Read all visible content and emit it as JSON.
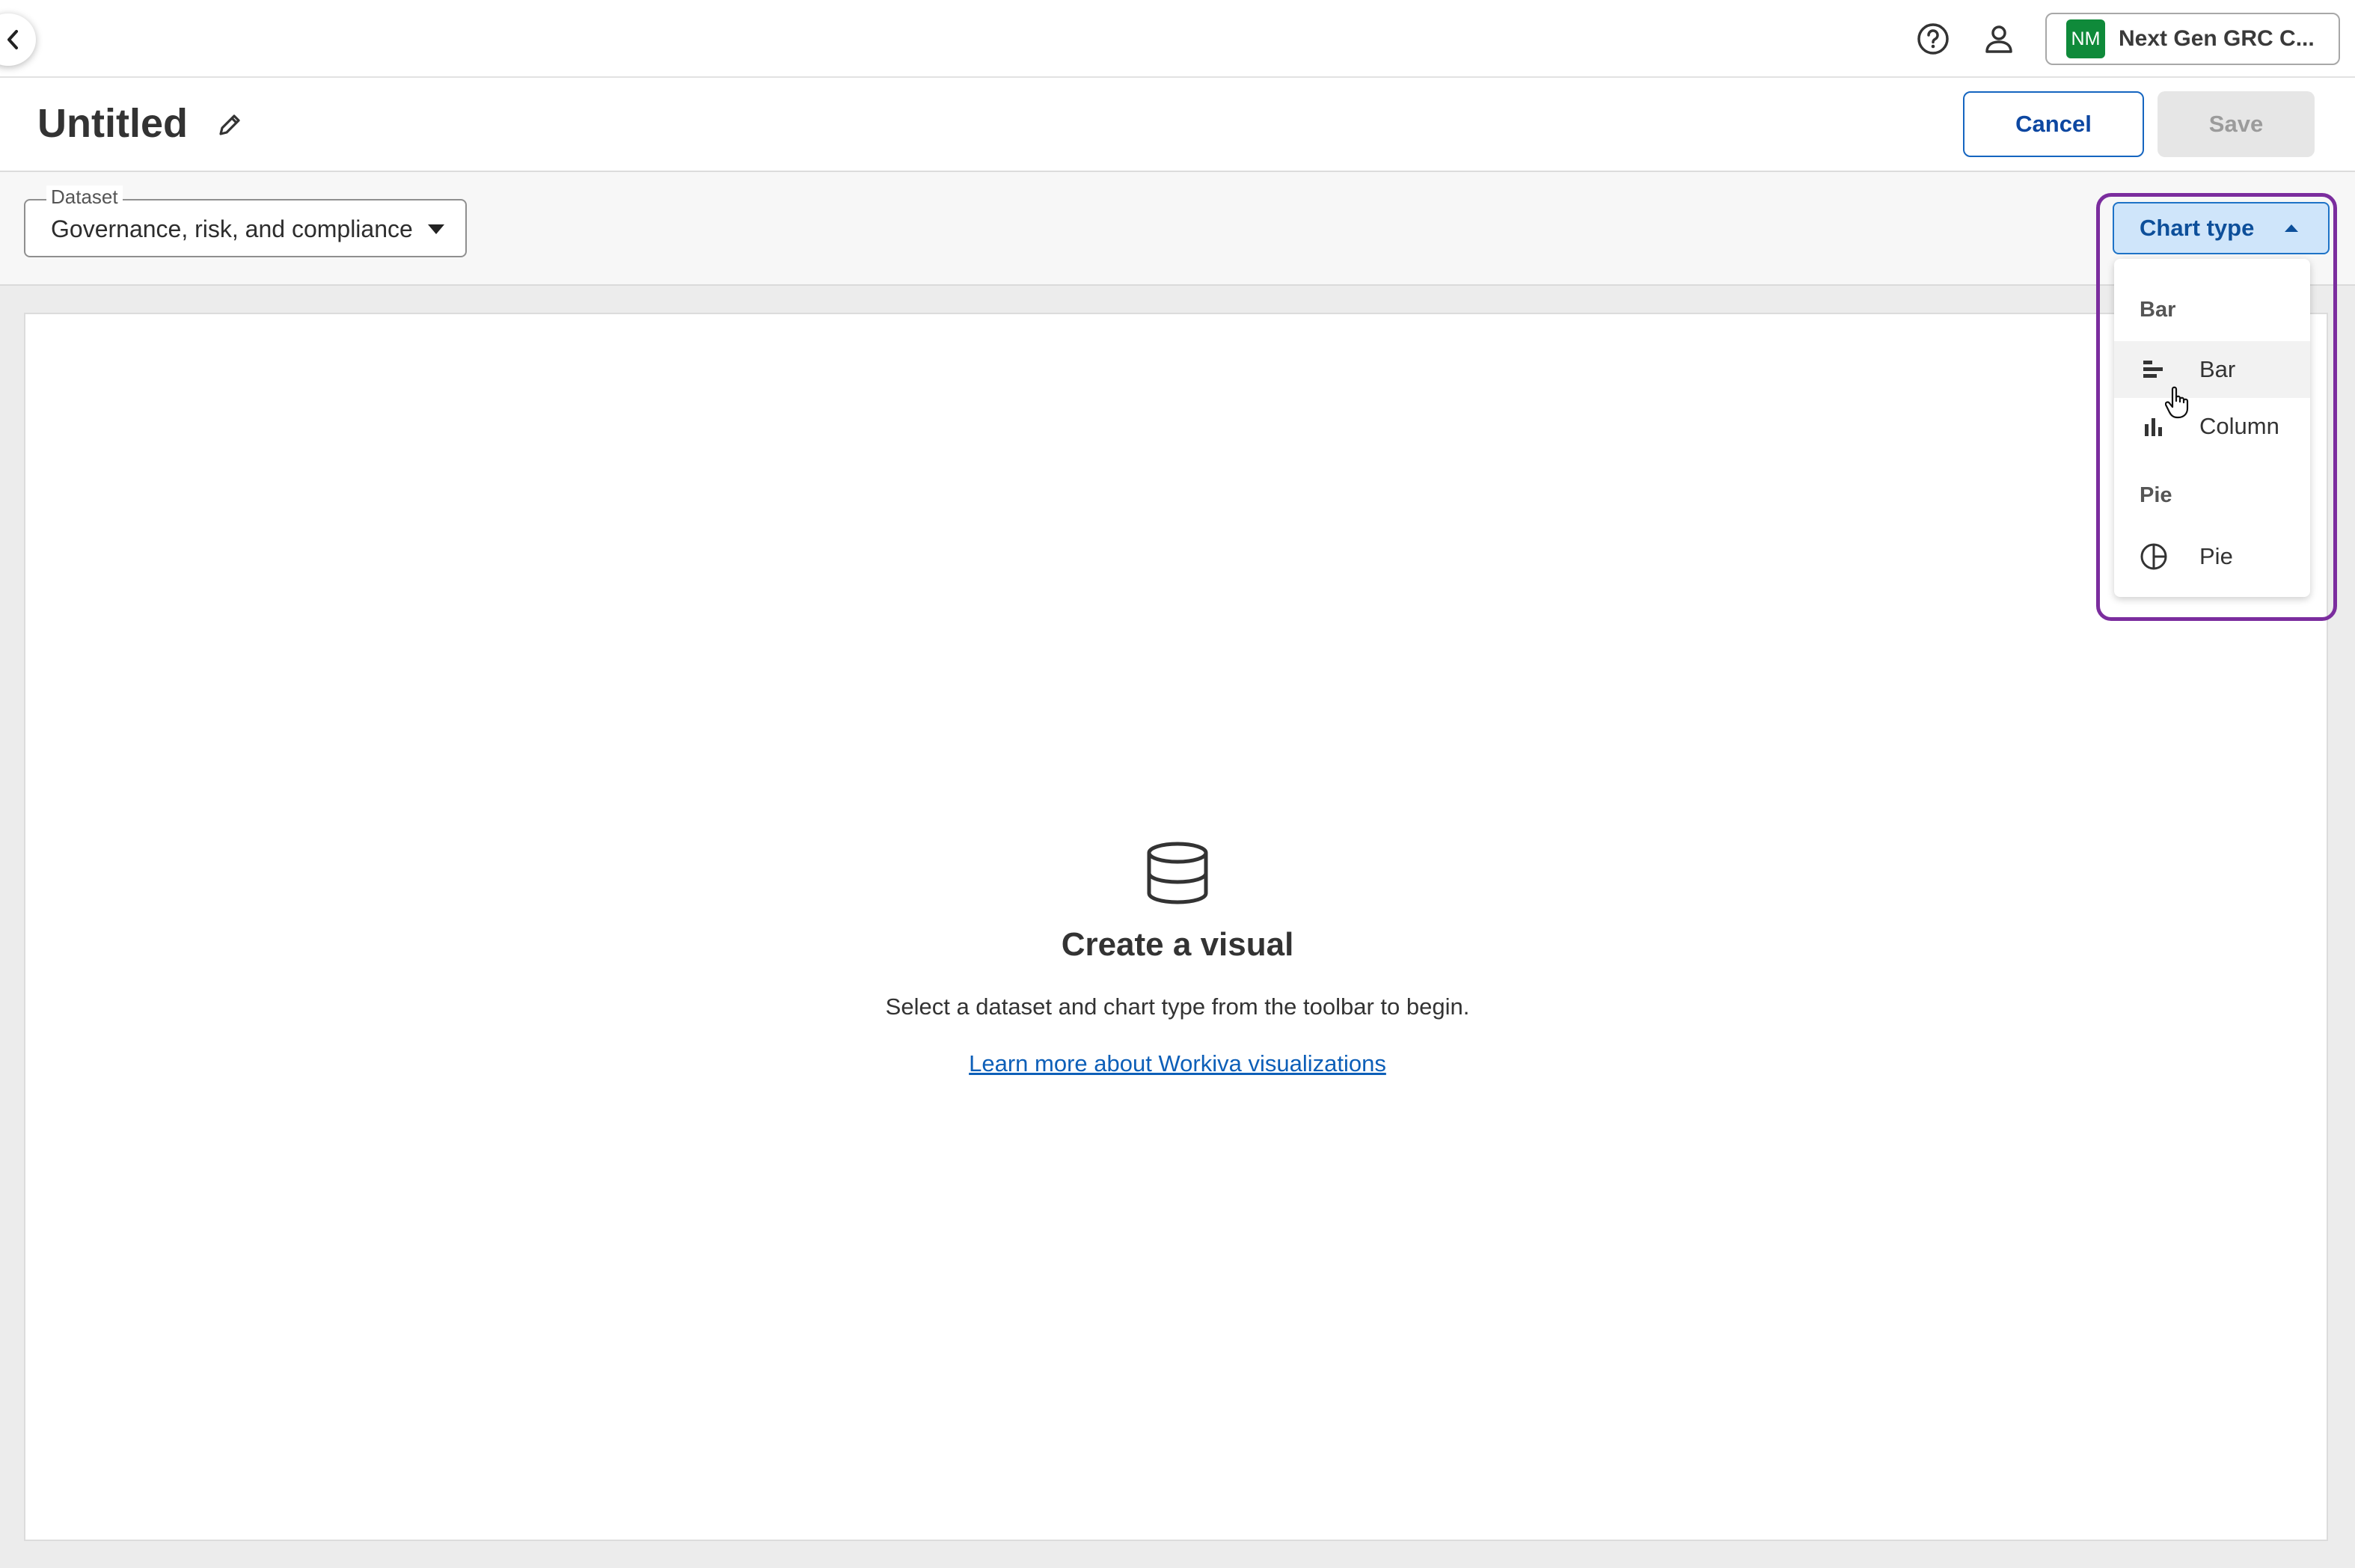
{
  "header": {
    "org": {
      "initials": "NM",
      "name": "Next Gen GRC C..."
    },
    "icons": {
      "back": "chevron-left-icon",
      "help": "help-circle-icon",
      "user": "user-icon"
    }
  },
  "title_bar": {
    "title": "Untitled",
    "cancel_label": "Cancel",
    "save_label": "Save"
  },
  "toolbar": {
    "dataset_label": "Dataset",
    "dataset_value": "Governance, risk, and compliance",
    "chart_type_label": "Chart type"
  },
  "chart_type_menu": {
    "groups": [
      {
        "heading": "Bar",
        "items": [
          {
            "label": "Bar",
            "icon": "bar-chart-icon"
          },
          {
            "label": "Column",
            "icon": "column-chart-icon"
          }
        ]
      },
      {
        "heading": "Pie",
        "items": [
          {
            "label": "Pie",
            "icon": "pie-chart-icon"
          }
        ]
      }
    ]
  },
  "empty_state": {
    "icon": "database-icon",
    "title": "Create a visual",
    "subtitle": "Select a dataset and chart type from the toolbar to begin.",
    "link": "Learn more about Workiva visualizations"
  },
  "colors": {
    "accent": "#1565c0",
    "highlight": "#7b2d9e",
    "org_avatar": "#0f8a3a"
  }
}
